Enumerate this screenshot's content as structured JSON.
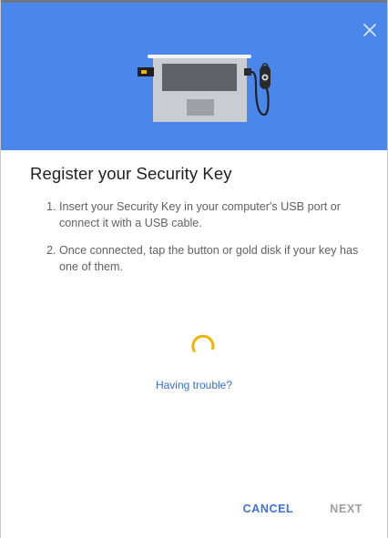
{
  "dialog": {
    "title": "Register your Security Key",
    "close_icon": "close-icon",
    "header_color": "#4b86ea",
    "illustration": "laptop-with-security-key-illustration"
  },
  "steps": [
    {
      "number": "1.",
      "text": "Insert your Security Key in your computer's USB port or connect it with a USB cable."
    },
    {
      "number": "2.",
      "text": "Once connected, tap the button or gold disk if your key has one of them."
    }
  ],
  "status": {
    "spinner_icon": "loading-spinner-icon",
    "spinner_color": "#f0b400",
    "help_link": "Having trouble?"
  },
  "actions": {
    "cancel_label": "CANCEL",
    "next_label": "NEXT",
    "accent_color": "#3b74d6",
    "disabled_color": "#9e9e9e"
  }
}
